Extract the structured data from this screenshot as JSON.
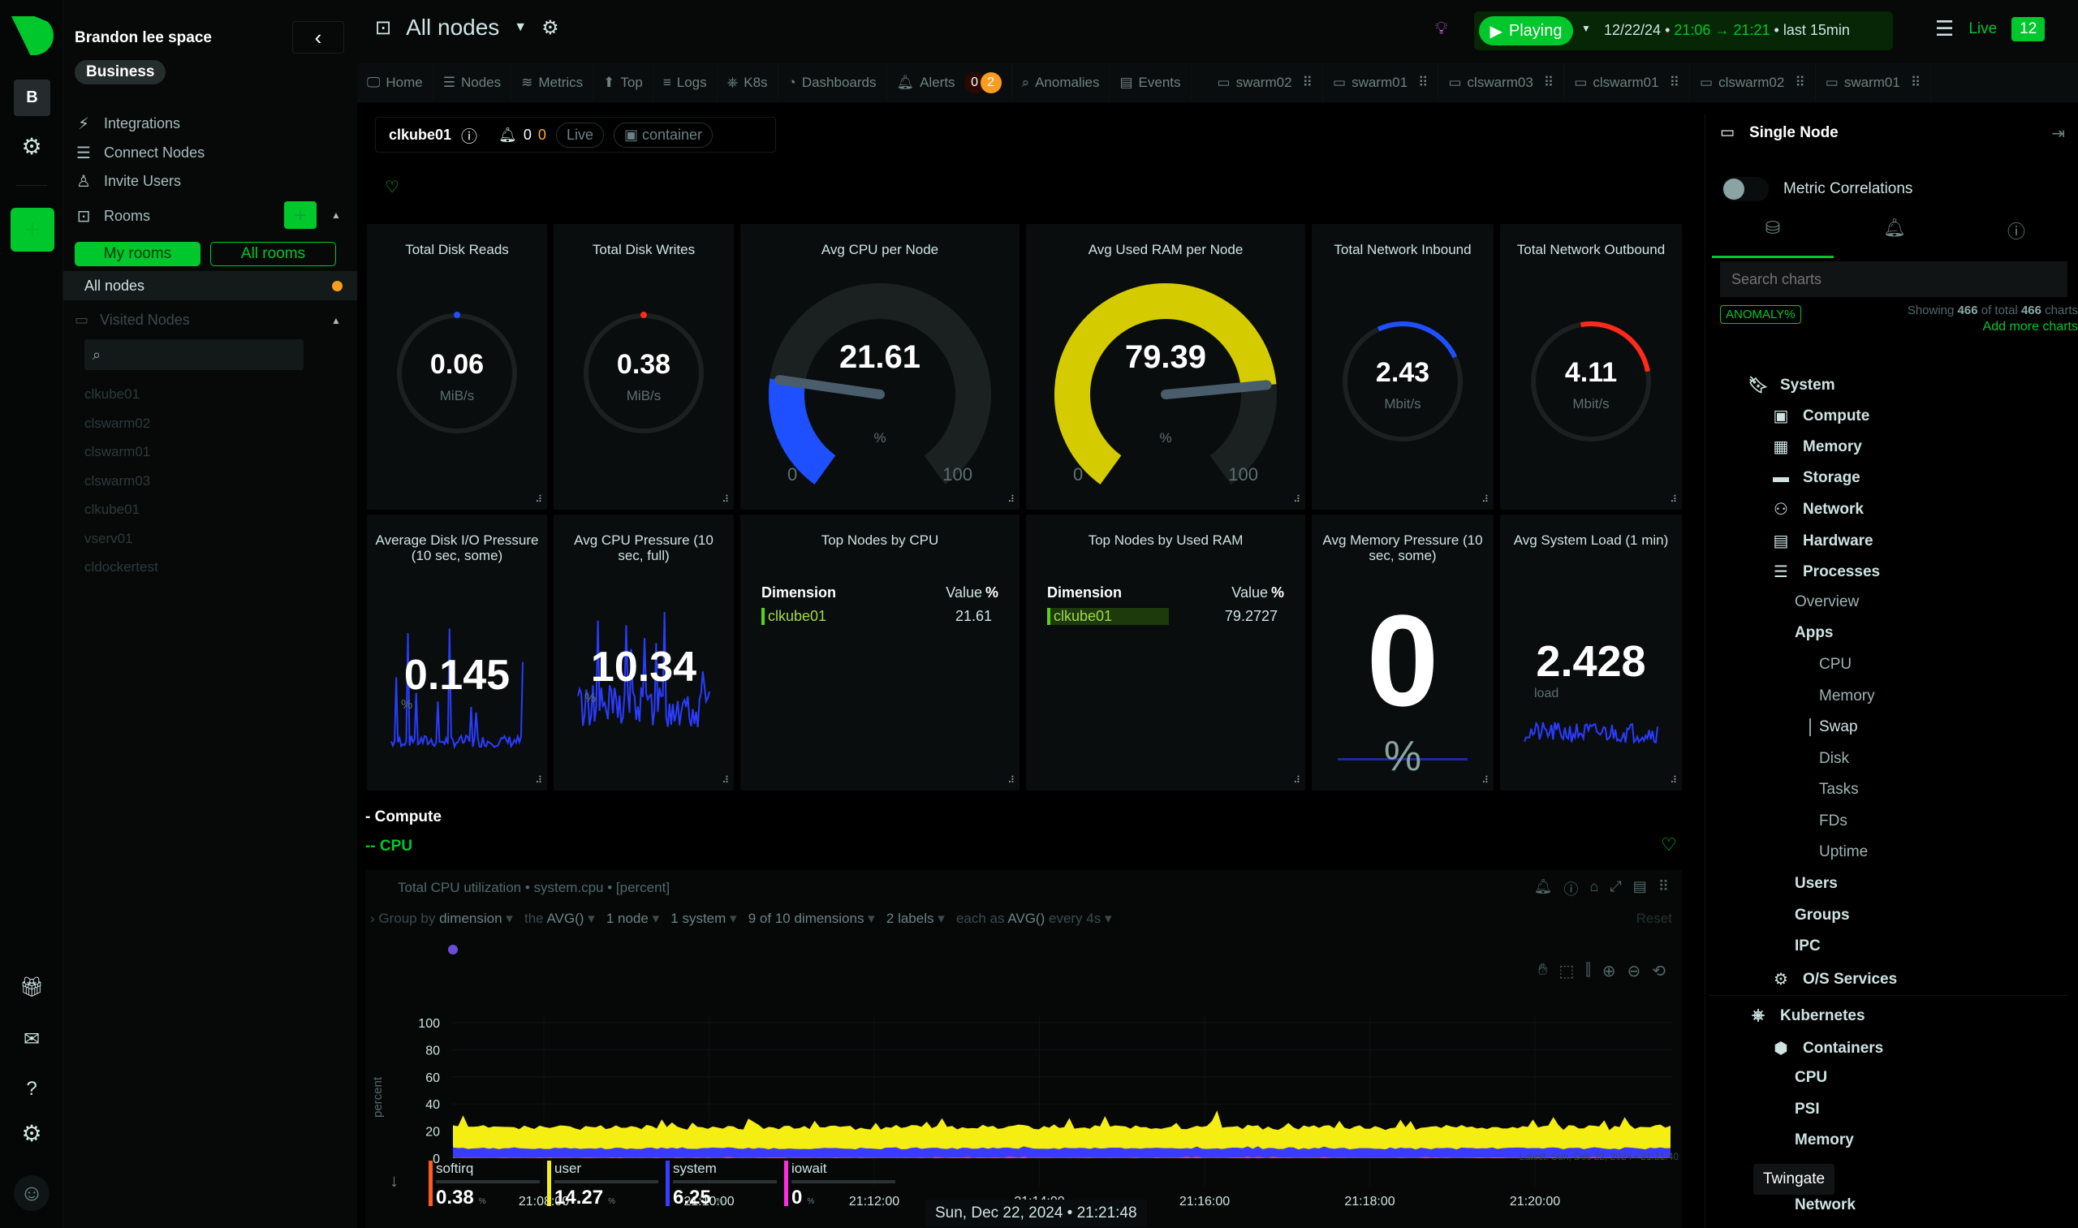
{
  "rail": {
    "space_initials": "B",
    "icons": [
      "netdata-logo-icon",
      "space-icon",
      "settings-icon",
      "add-space-icon",
      "gift-icon",
      "news-icon",
      "help-icon",
      "settings-icon",
      "user-avatar-icon"
    ]
  },
  "sidebar": {
    "space_name": "Brandon lee space",
    "plan": "Business",
    "links": [
      {
        "label": "Integrations",
        "icon": "plug-icon"
      },
      {
        "label": "Connect Nodes",
        "icon": "nodes-icon"
      },
      {
        "label": "Invite Users",
        "icon": "user-icon"
      }
    ],
    "rooms_label": "Rooms",
    "my_rooms": "My rooms",
    "all_rooms": "All rooms",
    "active_room": "All nodes",
    "visited_nodes_label": "Visited Nodes",
    "visited_search_placeholder": "",
    "visited_nodes": [
      "clkube01",
      "clswarm02",
      "clswarm01",
      "clswarm03",
      "clkube01",
      "vserv01",
      "cldockertest"
    ]
  },
  "header": {
    "room_title": "All nodes",
    "playing_label": "Playing",
    "date": "12/22/24",
    "time_from": "21:06",
    "time_to": "21:21",
    "last": "last  15min",
    "live_label": "Live",
    "live_count": "12"
  },
  "nav_tabs": [
    {
      "label": "Home",
      "icon": "monitor-icon"
    },
    {
      "label": "Nodes",
      "icon": "nodes-icon"
    },
    {
      "label": "Metrics",
      "icon": "metrics-icon"
    },
    {
      "label": "Top",
      "icon": "arrow-up-icon"
    },
    {
      "label": "Logs",
      "icon": "logs-icon"
    },
    {
      "label": "K8s",
      "icon": "kubernetes-icon"
    },
    {
      "label": "Dashboards",
      "icon": "dashboard-icon"
    },
    {
      "label": "Alerts",
      "icon": "bell-icon"
    },
    {
      "label": "Anomalies",
      "icon": "anomaly-icon"
    },
    {
      "label": "Events",
      "icon": "events-icon"
    }
  ],
  "alerts_badges": {
    "critical": "0",
    "warning": "2"
  },
  "node_tabs": [
    "swarm02",
    "swarm01",
    "clswarm03",
    "clswarm01",
    "clswarm02",
    "swarm01"
  ],
  "node_bar": {
    "node": "clkube01",
    "alert_crit": "0",
    "alert_warn": "0",
    "live": "Live",
    "container": "container"
  },
  "gauges": [
    {
      "title": "Total Disk Reads",
      "value": "0.06",
      "unit": "MiB/s"
    },
    {
      "title": "Total Disk Writes",
      "value": "0.38",
      "unit": "MiB/s"
    },
    {
      "title": "Avg CPU per Node",
      "value": "21.61",
      "unit": "%",
      "min": "0",
      "max": "100",
      "fraction": 0.2161
    },
    {
      "title": "Avg Used RAM per Node",
      "value": "79.39",
      "unit": "%",
      "min": "0",
      "max": "100",
      "fraction": 0.7939
    },
    {
      "title": "Total Network Inbound",
      "value": "2.43",
      "unit": "Mbit/s"
    },
    {
      "title": "Total Network Outbound",
      "value": "4.11",
      "unit": "Mbit/s"
    }
  ],
  "sparks": [
    {
      "title": "Average Disk I/O Pressure (10 sec, some)",
      "value": "0.145",
      "unit": "%"
    },
    {
      "title": "Avg CPU Pressure (10 sec, full)",
      "value": "10.34",
      "unit": "%"
    },
    {
      "title": "Avg Memory Pressure (10 sec, some)",
      "value": "0",
      "unit": "%"
    },
    {
      "title": "Avg System Load (1 min)",
      "value": "2.428",
      "unit": "load"
    }
  ],
  "top_cpu": {
    "title": "Top Nodes by CPU",
    "col1": "Dimension",
    "col2": "Value",
    "col2_unit": "%",
    "rows": [
      {
        "name": "clkube01",
        "value": "21.61"
      }
    ]
  },
  "top_ram": {
    "title": "Top Nodes by Used RAM",
    "col1": "Dimension",
    "col2": "Value",
    "col2_unit": "%",
    "rows": [
      {
        "name": "clkube01",
        "value": "79.2727"
      }
    ]
  },
  "sections": {
    "compute": "- Compute",
    "cpu": "-- CPU"
  },
  "cpu_chart": {
    "title": "Total CPU utilization • system.cpu • [percent]",
    "group_by": {
      "prefix": "Group by",
      "dimension": "dimension",
      "the": "the",
      "agg": "AVG()",
      "nodes": "1 node",
      "systems": "1 system",
      "dims": "9 of 10 dimensions",
      "labels": "2 labels",
      "each_as": "each as",
      "each_agg": "AVG()",
      "every": "every 4s",
      "reset": "Reset"
    },
    "latest": "Latest: Sun, Dec 22, 2024 • 21:21:40",
    "legend": [
      {
        "name": "softirq",
        "value": "0.38",
        "unit": "%",
        "color": "#ff5a1f"
      },
      {
        "name": "user",
        "value": "14.27",
        "unit": "%",
        "color": "#f5ee12"
      },
      {
        "name": "system",
        "value": "6.25",
        "unit": "%",
        "color": "#3b3bff"
      },
      {
        "name": "iowait",
        "value": "0",
        "unit": "%",
        "color": "#ff2ce0"
      }
    ]
  },
  "chart_data": {
    "type": "area",
    "title": "Total CPU utilization • system.cpu • [percent]",
    "xlabel": "",
    "ylabel": "percent",
    "ylim": [
      0,
      100
    ],
    "yticks": [
      "0",
      "20",
      "40",
      "60",
      "80",
      "100"
    ],
    "xticks": [
      "21:08:00",
      "21:10:00",
      "21:12:00",
      "21:14:00",
      "21:16:00",
      "21:18:00",
      "21:20:00"
    ],
    "stacked": true,
    "series": [
      {
        "name": "iowait",
        "color": "#ff2ce0",
        "typical": 0.2
      },
      {
        "name": "softirq",
        "color": "#ff5a1f",
        "typical": 0.4
      },
      {
        "name": "system",
        "color": "#3b3bff",
        "typical": 6.5
      },
      {
        "name": "user",
        "color": "#f5ee12",
        "typical": 15,
        "peak": 33
      }
    ]
  },
  "right_panel": {
    "title": "Single Node",
    "metric_correlations": "Metric Correlations",
    "search_placeholder": "Search charts",
    "anomaly_btn": "ANOMALY%",
    "showing_prefix": "Showing",
    "showing_count": "466",
    "showing_mid": "of total",
    "showing_total": "466",
    "showing_suffix": "charts",
    "add_more": "Add more charts",
    "toc": [
      {
        "label": "System",
        "level": 0,
        "bold": true,
        "icon": "bookmark-icon"
      },
      {
        "label": "Compute",
        "level": 1,
        "bold": true,
        "icon": "cpu-icon"
      },
      {
        "label": "Memory",
        "level": 1,
        "bold": true,
        "icon": "memory-icon"
      },
      {
        "label": "Storage",
        "level": 1,
        "bold": true,
        "icon": "storage-icon"
      },
      {
        "label": "Network",
        "level": 1,
        "bold": true,
        "icon": "network-icon"
      },
      {
        "label": "Hardware",
        "level": 1,
        "bold": true,
        "icon": "hardware-icon"
      },
      {
        "label": "Processes",
        "level": 1,
        "bold": true,
        "icon": "processes-icon"
      },
      {
        "label": "Overview",
        "level": 2,
        "bold": false
      },
      {
        "label": "Apps",
        "level": 2,
        "bold": true
      },
      {
        "label": "CPU",
        "level": 3,
        "bold": false
      },
      {
        "label": "Memory",
        "level": 3,
        "bold": false
      },
      {
        "label": "Swap",
        "level": 3,
        "bold": false,
        "active": true
      },
      {
        "label": "Disk",
        "level": 3,
        "bold": false
      },
      {
        "label": "Tasks",
        "level": 3,
        "bold": false
      },
      {
        "label": "FDs",
        "level": 3,
        "bold": false
      },
      {
        "label": "Uptime",
        "level": 3,
        "bold": false
      },
      {
        "label": "Users",
        "level": 2,
        "bold": true
      },
      {
        "label": "Groups",
        "level": 2,
        "bold": true
      },
      {
        "label": "IPC",
        "level": 2,
        "bold": true
      },
      {
        "label": "O/S Services",
        "level": 1,
        "bold": true,
        "icon": "gears-icon"
      },
      {
        "label": "Kubernetes",
        "level": 0,
        "bold": true,
        "icon": "kubernetes-icon"
      },
      {
        "label": "Containers",
        "level": 1,
        "bold": true,
        "icon": "container-icon"
      },
      {
        "label": "CPU",
        "level": 2,
        "bold": true
      },
      {
        "label": "PSI",
        "level": 2,
        "bold": true
      },
      {
        "label": "Memory",
        "level": 2,
        "bold": true
      },
      {
        "label": "Network",
        "level": 2,
        "bold": true
      }
    ]
  },
  "tooltip": "Twingate",
  "footer_date": "Sun, Dec 22, 2024 • 21:21:48"
}
